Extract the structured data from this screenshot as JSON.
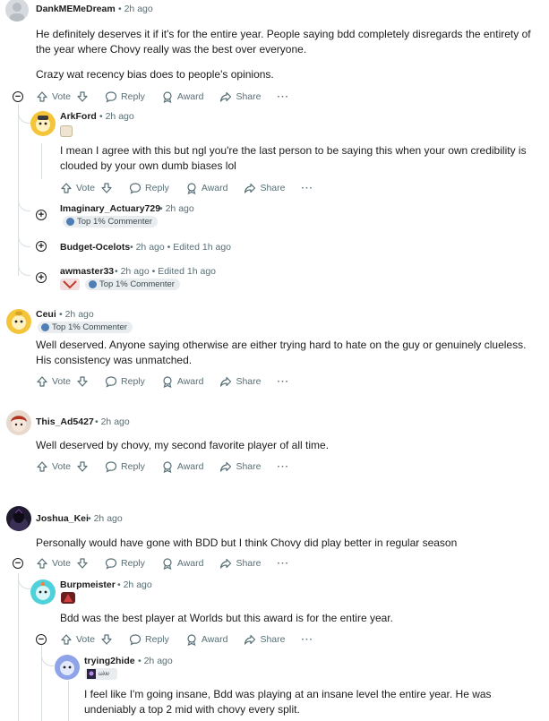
{
  "actions": {
    "vote": "Vote",
    "reply": "Reply",
    "award": "Award",
    "share": "Share",
    "more": "···"
  },
  "comments": [
    {
      "user": "DankMEMeDream",
      "time": "• 2h ago",
      "text1": "He definitely deserves it if it's for the entire year. People saying bdd completely disregards the entirety of the year where Chovy really was the best over everyone.",
      "text2": "Crazy wat recency bias does to people's opinions."
    },
    {
      "user": "ArkFord",
      "time": "• 2h ago",
      "text": "I mean I agree with this but ngl you're the last person to be saying this when your own credibility is clouded by your own dumb biases lol"
    },
    {
      "user": "Imaginary_Actuary729",
      "time": "• 2h ago",
      "badge": "Top 1% Commenter"
    },
    {
      "user": "Budget-Ocelots",
      "time": "• 2h ago • Edited 1h ago"
    },
    {
      "user": "awmaster33",
      "time": "• 2h ago • Edited 1h ago",
      "badge": "Top 1% Commenter"
    },
    {
      "user": "Ceui",
      "time": "• 2h ago",
      "badge": "Top 1% Commenter",
      "text": "Well deserved. Anyone saying otherwise are either trying hard to hate on the guy or genuinely clueless. His consistency was unmatched."
    },
    {
      "user": "This_Ad5427",
      "time": "• 2h ago",
      "text": "Well deserved by chovy, my second favorite player of all time."
    },
    {
      "user": "Joshua_Kei",
      "time": "• 2h ago",
      "text": "Personally would have gone with BDD but I think Chovy did play better in regular season"
    },
    {
      "user": "Burpmeister",
      "time": "• 2h ago",
      "text": "Bdd was the best player at Worlds but this award is for the entire year."
    },
    {
      "user": "trying2hide",
      "time": "• 2h ago",
      "flair": "ωλιν",
      "text": "I feel like I'm going insane, Bdd was playing at an insane level the entire year. He was undeniably a top 2 mid with chovy every split."
    }
  ],
  "colors": {
    "link_gray": "#576f76",
    "thread_line": "#d8dde0",
    "badge_bg": "#eaedef"
  }
}
